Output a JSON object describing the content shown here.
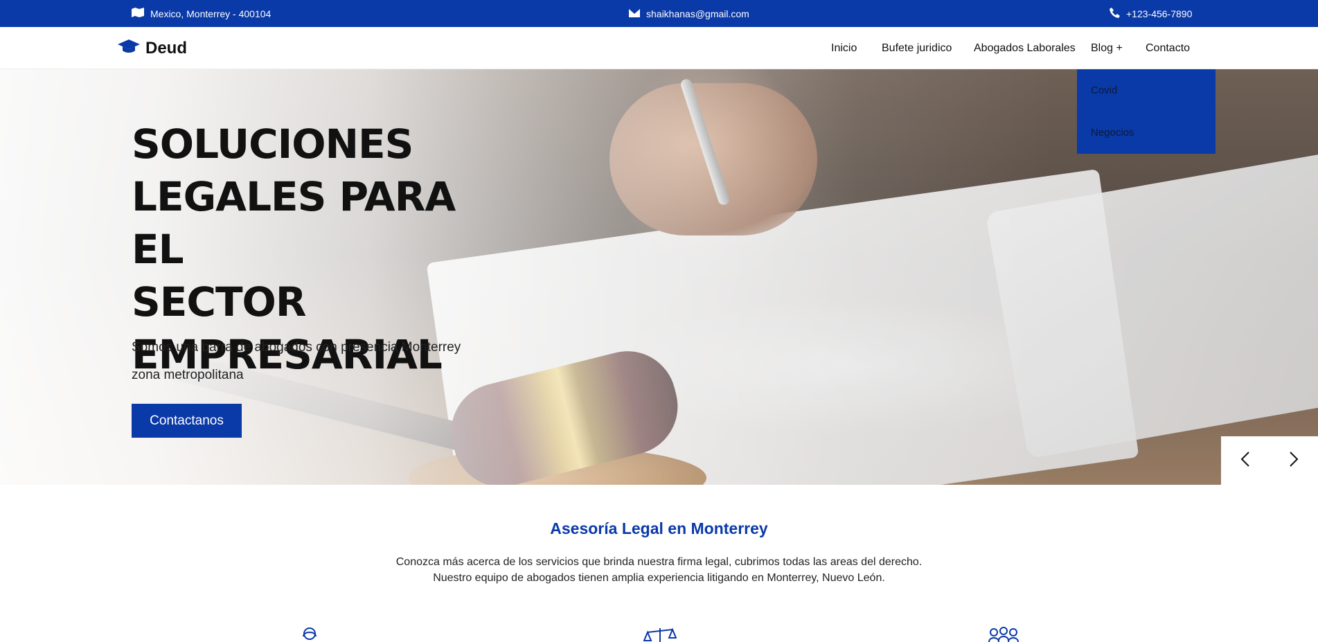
{
  "topbar": {
    "address": "Mexico, Monterrey - 400104",
    "address_icon": "map-icon",
    "email": "shaikhanas@gmail.com",
    "email_icon": "envelope-icon",
    "phone": "+123-456-7890",
    "phone_icon": "phone-icon",
    "background": "#0a39a8"
  },
  "nav": {
    "brand": "Deud",
    "brand_icon": "graduation-cap-icon",
    "links": [
      "Inicio",
      "Bufete juridico",
      "Abogados Laborales",
      "Blog +",
      "Contacto"
    ],
    "dropdown": [
      "Covid",
      "Negocios"
    ]
  },
  "hero": {
    "title_lines": [
      "SOLUCIONES",
      "LEGALES PARA EL",
      "SECTOR",
      "EMPRESARIAL"
    ],
    "subtitle": "Somos una barra de abogados con presencia Monterrey zona metropolitana",
    "button": "Contactanos",
    "prev_icon": "chevron-left-icon",
    "next_icon": "chevron-right-icon"
  },
  "section": {
    "title": "Asesoría Legal en Monterrey",
    "text_line1": "Conozca más acerca de los servicios que brinda nuestra firma legal, cubrimos todas las areas del derecho.",
    "text_line2": "Nuestro equipo de abogados tienen amplia experiencia litigando en Monterrey, Nuevo León.",
    "icons": [
      "lawyer-icon",
      "scales-icon",
      "team-icon"
    ]
  },
  "colors": {
    "accent": "#0a39a8"
  }
}
